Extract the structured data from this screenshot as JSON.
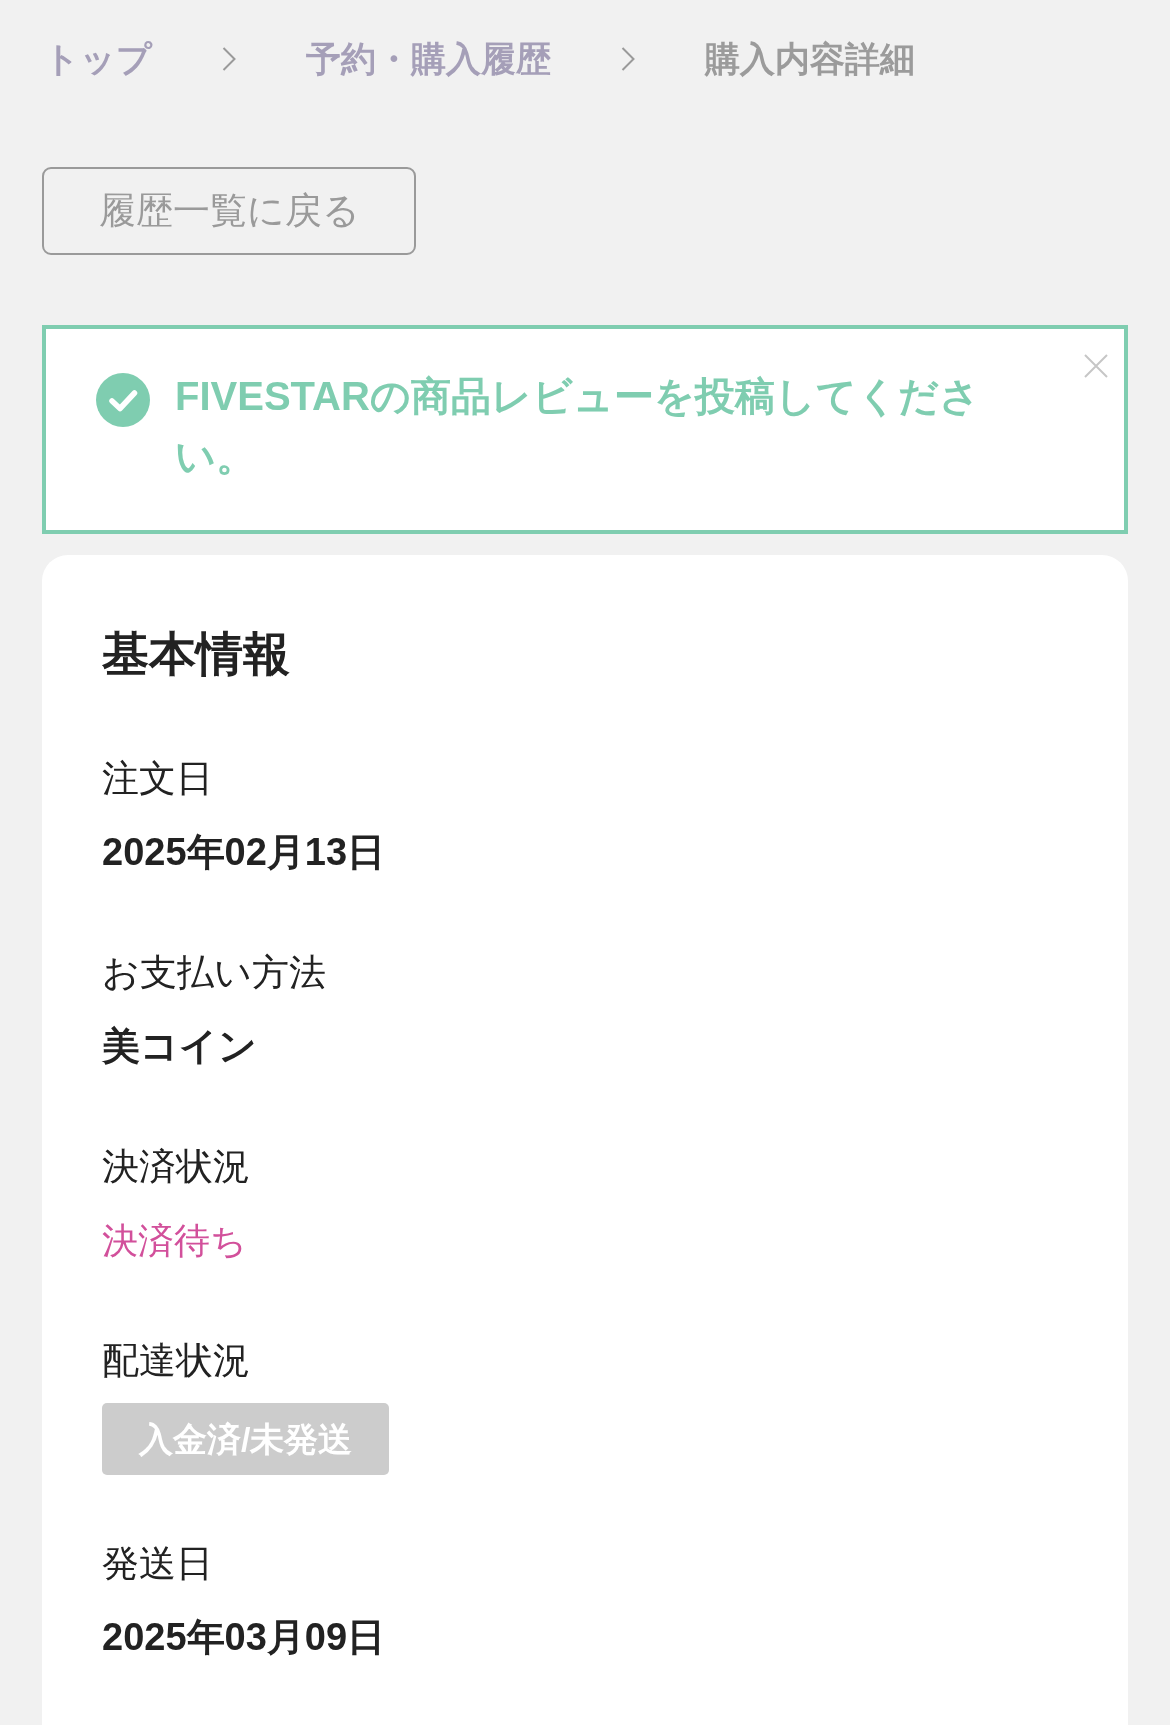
{
  "breadcrumb": [
    {
      "label": "トップ",
      "current": false
    },
    {
      "label": "予約・購入履歴",
      "current": false
    },
    {
      "label": "購入内容詳細",
      "current": true
    }
  ],
  "back_button": {
    "label": "履歴一覧に戻る"
  },
  "alert": {
    "kind": "success",
    "message": "FIVESTARの商品レビューを投稿してください。",
    "dismissible": true
  },
  "basic_info": {
    "title": "基本情報",
    "fields": [
      {
        "label": "注文日",
        "value": "2025年02月13日",
        "kind": "text"
      },
      {
        "label": "お支払い方法",
        "value": "美コイン",
        "kind": "text"
      },
      {
        "label": "決済状況",
        "value": "決済待ち",
        "kind": "status"
      },
      {
        "label": "配達状況",
        "value": "入金済/未発送",
        "kind": "badge"
      },
      {
        "label": "発送日",
        "value": "2025年03月09日",
        "kind": "text"
      }
    ]
  }
}
